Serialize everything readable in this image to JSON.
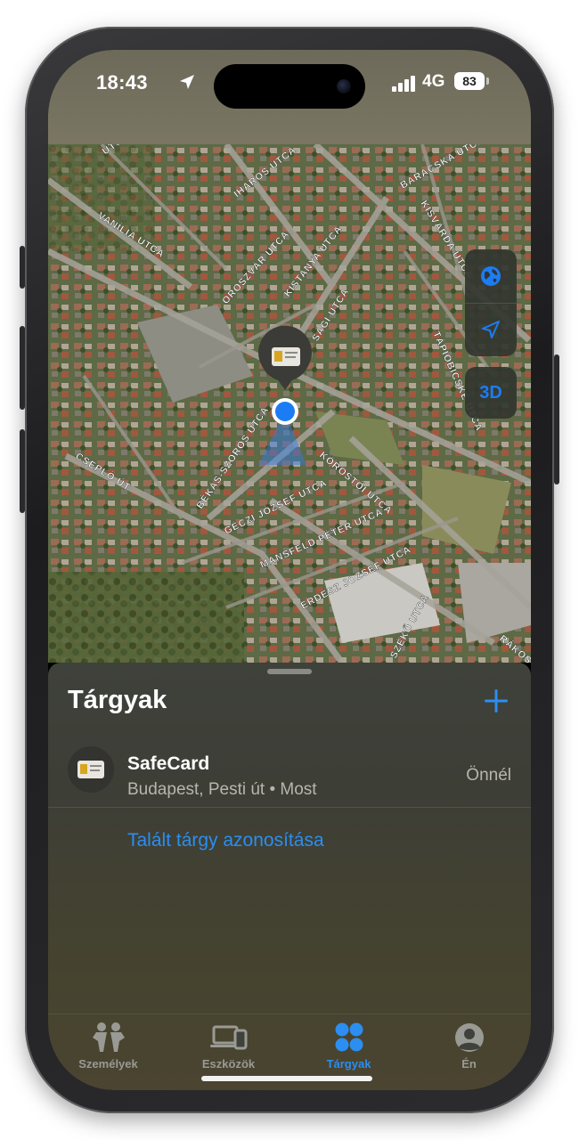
{
  "status_bar": {
    "time": "18:43",
    "network": "4G",
    "battery": "83",
    "icons": [
      "location-arrow-icon",
      "signal-icon",
      "battery-icon"
    ]
  },
  "map": {
    "street_labels": [
      "IHAROS UTCA",
      "BARACSKA UTCA",
      "VANÍLIA UTCA",
      "KISVÁRDA UTCA",
      "KISTANYA UTCA",
      "OROSZVÁR UTCA",
      "SÁGI UTCA",
      "TÁPIÓBICSKE UTCA",
      "BÉKÁS-SZOROS UTCA",
      "CSEPLŐ ÚT",
      "KŐRÖSTŐI UTCA",
      "GÉCZI JÓZSEF UTCA",
      "MANSFELD PÉTER UTCA",
      "ERDÉSZ JÓZSEF UTCA",
      "RÁKOS",
      "SZÉKŐ UTCA",
      "UTCA"
    ],
    "controls": {
      "globe_icon": "globe-icon",
      "locate_icon": "location-arrow-icon",
      "mode_3d": "3D"
    },
    "accent": "#1c7cf4"
  },
  "sheet": {
    "title": "Tárgyak",
    "add_icon": "plus-icon",
    "item": {
      "name": "SafeCard",
      "location": "Budapest, Pesti út • Most",
      "status": "Önnél",
      "icon": "card-icon"
    },
    "identify_link": "Talált tárgy azonosítása"
  },
  "tabs": [
    {
      "label": "Személyek",
      "icon": "people-icon",
      "active": false
    },
    {
      "label": "Eszközök",
      "icon": "devices-icon",
      "active": false
    },
    {
      "label": "Tárgyak",
      "icon": "items-icon",
      "active": true
    },
    {
      "label": "Én",
      "icon": "person-circle-icon",
      "active": false
    }
  ],
  "colors": {
    "accent_blue": "#2b8ef0",
    "sheet_bg": "#3f413b",
    "secondary_text": "#b7b6ac"
  }
}
